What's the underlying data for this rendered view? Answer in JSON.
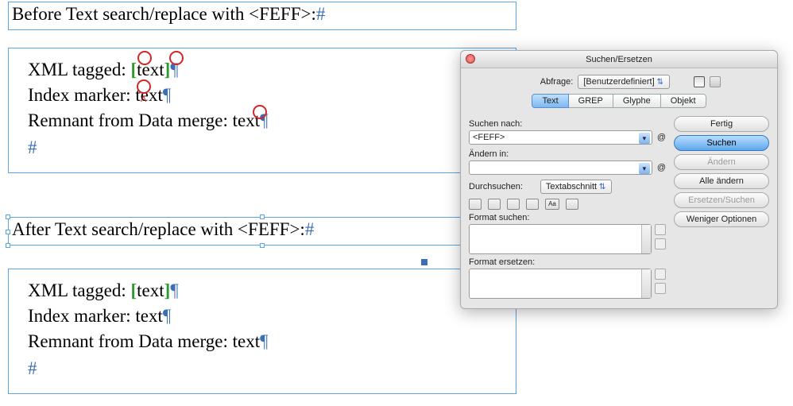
{
  "before": {
    "title": "Before Text search/replace with <FEFF>:",
    "lines": {
      "l1a": "XML tagged: ",
      "l1b": "text",
      "l2a": "Index marker: ",
      "l2b": "text",
      "l3a": "Remnant from Data merge: ",
      "l3b": "text"
    }
  },
  "after": {
    "title": "After Text search/replace with <FEFF>:",
    "lines": {
      "l1a": "XML tagged: ",
      "l1b": "text",
      "l2a": "Index marker: text",
      "l3a": "Remnant from Data merge: text"
    }
  },
  "glyphs": {
    "pilcrow": "¶",
    "hash": "#",
    "lbracket": "[",
    "rbracket": "]"
  },
  "dialog": {
    "title": "Suchen/Ersetzen",
    "query_label": "Abfrage:",
    "query_value": "[Benutzerdefiniert]",
    "tabs": {
      "text": "Text",
      "grep": "GREP",
      "glyphe": "Glyphe",
      "objekt": "Objekt"
    },
    "search_label": "Suchen nach:",
    "search_value": "<FEFF>",
    "change_label": "Ändern in:",
    "change_value": "",
    "scope_label": "Durchsuchen:",
    "scope_value": "Textabschnitt",
    "fmt_search": "Format suchen:",
    "fmt_replace": "Format ersetzen:",
    "buttons": {
      "done": "Fertig",
      "search": "Suchen",
      "change": "Ändern",
      "change_all": "Alle ändern",
      "replace_search": "Ersetzen/Suchen",
      "fewer": "Weniger Optionen"
    }
  }
}
